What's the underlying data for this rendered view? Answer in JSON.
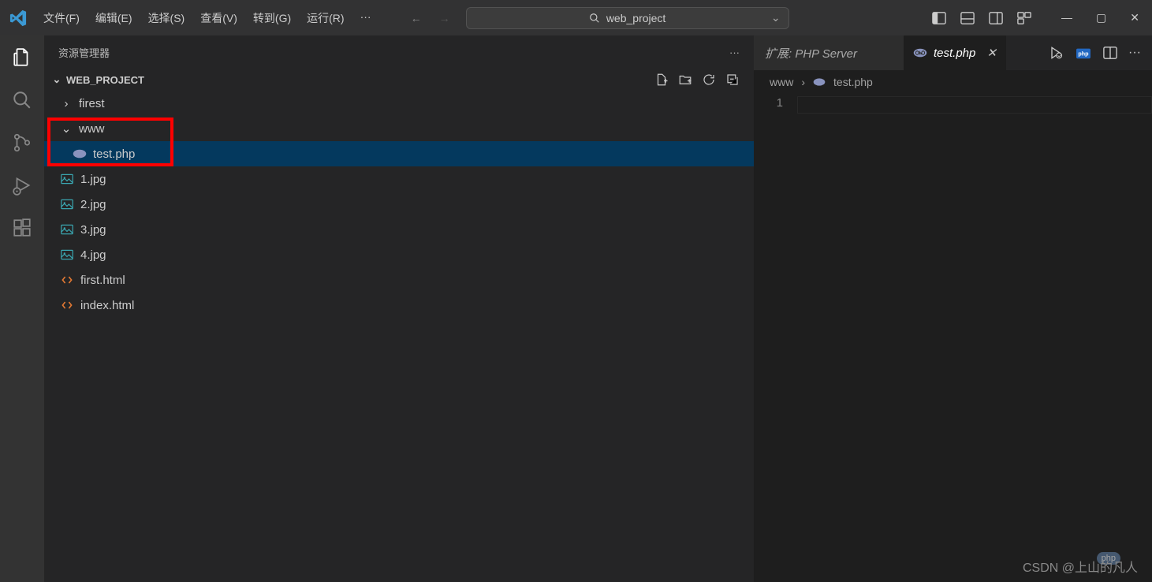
{
  "title_bar": {
    "menus": [
      "文件(F)",
      "编辑(E)",
      "选择(S)",
      "查看(V)",
      "转到(G)",
      "运行(R)"
    ],
    "search": "web_project"
  },
  "sidebar": {
    "title": "资源管理器",
    "project": "WEB_PROJECT",
    "tree": [
      {
        "type": "folder",
        "name": "firest",
        "expanded": false,
        "depth": 1
      },
      {
        "type": "folder",
        "name": "www",
        "expanded": true,
        "depth": 1,
        "highlighted": true
      },
      {
        "type": "file",
        "name": "test.php",
        "icon": "php",
        "depth": 2,
        "selected": true,
        "highlighted": true
      },
      {
        "type": "file",
        "name": "1.jpg",
        "icon": "img",
        "depth": 1
      },
      {
        "type": "file",
        "name": "2.jpg",
        "icon": "img",
        "depth": 1
      },
      {
        "type": "file",
        "name": "3.jpg",
        "icon": "img",
        "depth": 1
      },
      {
        "type": "file",
        "name": "4.jpg",
        "icon": "img",
        "depth": 1
      },
      {
        "type": "file",
        "name": "first.html",
        "icon": "html",
        "depth": 1
      },
      {
        "type": "file",
        "name": "index.html",
        "icon": "html",
        "depth": 1
      }
    ]
  },
  "tabs": {
    "inactive_label": "扩展: PHP Server",
    "active_label": "test.php"
  },
  "breadcrumb": {
    "segment1": "www",
    "segment2": "test.php"
  },
  "editor": {
    "line_number": "1"
  },
  "watermark": "CSDN @上山的凡人",
  "badge": "php"
}
